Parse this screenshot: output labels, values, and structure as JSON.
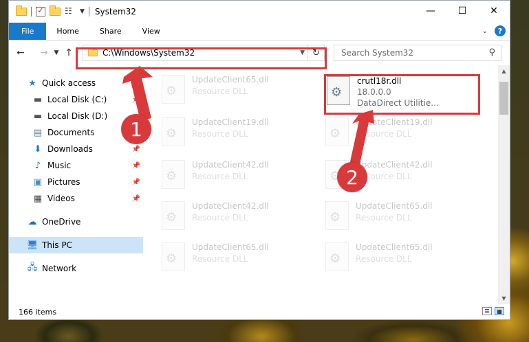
{
  "window": {
    "title": "System32",
    "controls": {
      "minimize": "—",
      "maximize": "☐",
      "close": "✕"
    }
  },
  "ribbon": {
    "tabs": [
      "File",
      "Home",
      "Share",
      "View"
    ]
  },
  "nav": {
    "address": "C:\\Windows\\System32",
    "search_placeholder": "Search System32"
  },
  "sidebar": {
    "items": [
      {
        "label": "Quick access",
        "icon": "star-icon",
        "pinned": false
      },
      {
        "label": "Local Disk (C:)",
        "icon": "drive-icon",
        "pinned": true
      },
      {
        "label": "Local Disk (D:)",
        "icon": "drive-icon",
        "pinned": false
      },
      {
        "label": "Documents",
        "icon": "documents-icon",
        "pinned": true
      },
      {
        "label": "Downloads",
        "icon": "download-icon",
        "pinned": true
      },
      {
        "label": "Music",
        "icon": "music-icon",
        "pinned": true
      },
      {
        "label": "Pictures",
        "icon": "pictures-icon",
        "pinned": true
      },
      {
        "label": "Videos",
        "icon": "videos-icon",
        "pinned": true
      },
      {
        "label": "OneDrive",
        "icon": "cloud-icon",
        "pinned": false
      },
      {
        "label": "This PC",
        "icon": "computer-icon",
        "pinned": false,
        "selected": true
      },
      {
        "label": "Network",
        "icon": "network-icon",
        "pinned": false
      }
    ]
  },
  "files": [
    {
      "name": "UpdateClient65.dll",
      "sub": "Resource DLL"
    },
    {
      "name": "crutl18r.dll",
      "sub": "18.0.0.0",
      "sub2": "DataDirect Utilitie...",
      "highlighted": true
    },
    {
      "name": "UpdateClient19.dll",
      "sub": "Resource DLL"
    },
    {
      "name": "UpdateClient19.dll",
      "sub": "Resource DLL"
    },
    {
      "name": "UpdateClient42.dll",
      "sub": "Resource DLL"
    },
    {
      "name": "UpdateClient42.dll",
      "sub": "Resource DLL"
    },
    {
      "name": "UpdateClient42.dll",
      "sub": "Resource DLL"
    },
    {
      "name": "UpdateClient65.dll",
      "sub": "Resource DLL"
    },
    {
      "name": "UpdateClient65.dll",
      "sub": "Resource DLL"
    },
    {
      "name": "UpdateClient65.dll",
      "sub": "Resource DLL"
    }
  ],
  "status": {
    "count": "166 items"
  },
  "annotations": {
    "step1": "1",
    "step2": "2",
    "color": "#d8393a"
  }
}
